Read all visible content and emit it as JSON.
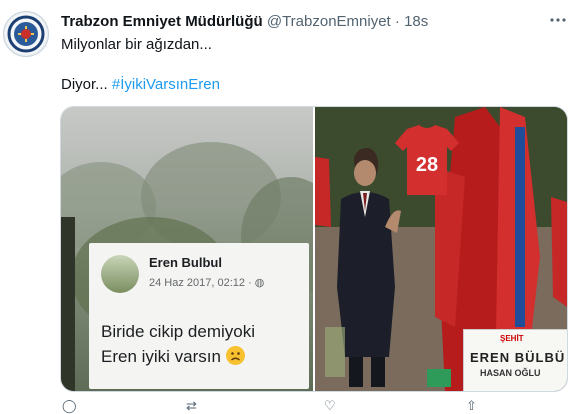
{
  "tweet": {
    "display_name": "Trabzon Emniyet Müdürlüğü",
    "handle": "@TrabzonEmniyet",
    "separator": "·",
    "time": "18s",
    "text_line1": "Milyonlar bir ağızdan...",
    "text_line2_prefix": "Diyor... ",
    "hashtag": "#İyikiVarsınEren"
  },
  "embedded_post": {
    "author": "Eren Bulbul",
    "date": "24 Haz 2017, 02:12 · ",
    "line1": "Biride cikip demiyoki",
    "line2": "Eren iyiki varsın "
  },
  "right_photo": {
    "jersey_number": "28",
    "sign_top": "ŞEHİT",
    "sign_name": "EREN BÜLBÜ",
    "sign_sub": "HASAN OĞLU"
  },
  "icons": [
    "more-icon",
    "reply-icon",
    "retweet-icon",
    "like-icon",
    "share-icon"
  ],
  "colors": {
    "accent": "#1d9bf0",
    "secondary_text": "#536471"
  }
}
